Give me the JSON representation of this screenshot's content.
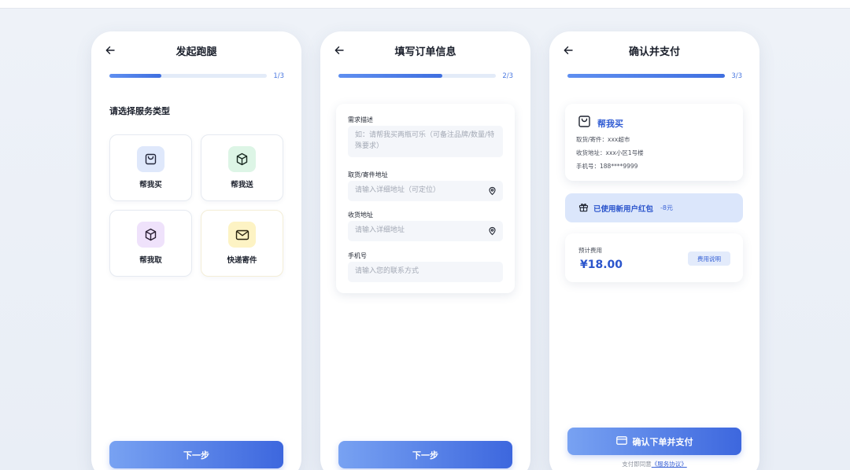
{
  "screen1": {
    "title": "发起跑腿",
    "progress_text": "1/3",
    "progress_fraction": 0.33,
    "section_title": "请选择服务类型",
    "services": [
      {
        "label": "帮我买",
        "icon": "shopping-bag-icon",
        "color": "#dfe8fb",
        "stroke": "#2f4fb0"
      },
      {
        "label": "帮我送",
        "icon": "package-icon",
        "color": "#ddf5e6",
        "stroke": "#1c6b3a"
      },
      {
        "label": "帮我取",
        "icon": "package-icon",
        "color": "#efe2fb",
        "stroke": "#5a2a8f"
      },
      {
        "label": "快递寄件",
        "icon": "mail-icon",
        "color": "#fdf3c4",
        "stroke": "#7a5a00"
      }
    ],
    "next_label": "下一步"
  },
  "screen2": {
    "title": "填写订单信息",
    "progress_text": "2/3",
    "progress_fraction": 0.66,
    "fields": [
      {
        "label": "需求描述",
        "placeholder": "如：请帮我买两瓶可乐（可备注品牌/数量/特殊要求）"
      },
      {
        "label": "取货/寄件地址",
        "placeholder": "请输入详细地址（可定位）"
      },
      {
        "label": "收货地址",
        "placeholder": "请输入详细地址"
      },
      {
        "label": "手机号",
        "placeholder": "请输入您的联系方式"
      }
    ],
    "next_label": "下一步"
  },
  "screen3": {
    "title": "确认并支付",
    "progress_text": "3/3",
    "progress_fraction": 1.0,
    "order": {
      "service": "帮我买",
      "pickup": "取货/寄件：xxx超市",
      "delivery": "收货地址：xxx小区1号楼",
      "phone": "手机号：188****9999"
    },
    "coupon": {
      "text": "已使用新用户红包",
      "amount": "-8元"
    },
    "fee": {
      "label": "预计费用",
      "amount": "¥18.00",
      "detail_button": "费用说明"
    },
    "pay_label": "确认下单并支付",
    "agreement_prefix": "支付即同意",
    "agreement_link": "《服务协议》"
  },
  "colors": {
    "accent": "#3d67de",
    "accent_light": "#78a2f2",
    "progress_track": "#e3ebf8"
  }
}
